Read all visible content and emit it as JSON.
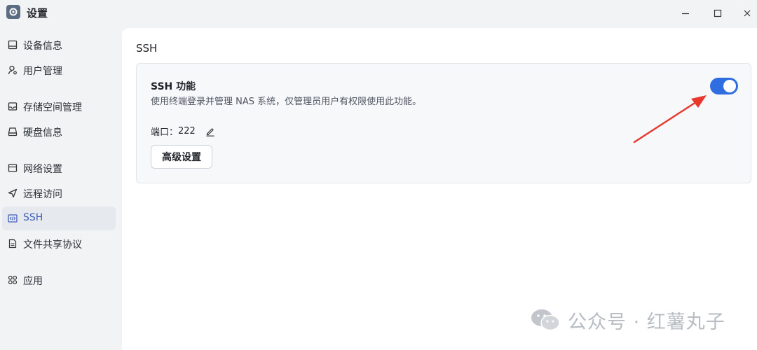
{
  "window": {
    "title": "设置",
    "controls": {
      "minimize": "minimize-icon",
      "maximize": "maximize-icon",
      "close": "close-icon"
    }
  },
  "sidebar": {
    "items": [
      {
        "label": "设备信息",
        "icon": "device-icon"
      },
      {
        "label": "用户管理",
        "icon": "user-icon"
      },
      {
        "label": "存储空间管理",
        "icon": "storage-icon"
      },
      {
        "label": "硬盘信息",
        "icon": "disk-icon"
      },
      {
        "label": "网络设置",
        "icon": "network-icon"
      },
      {
        "label": "远程访问",
        "icon": "remote-icon"
      },
      {
        "label": "SSH",
        "icon": "code-icon",
        "active": true
      },
      {
        "label": "文件共享协议",
        "icon": "document-icon"
      },
      {
        "label": "应用",
        "icon": "apps-icon"
      }
    ]
  },
  "main": {
    "page_title": "SSH",
    "card": {
      "title": "SSH 功能",
      "description": "使用终端登录并管理 NAS 系统，仅管理员用户有权限使用此功能。",
      "port_label": "端口：",
      "port_value": "222",
      "advanced_button": "高级设置",
      "toggle_on": true
    }
  },
  "watermark": {
    "text": "公众号 · 红薯丸子"
  },
  "colors": {
    "accent": "#2f6de0",
    "arrow": "#e8392e",
    "active_nav": "#3f5fb8"
  }
}
